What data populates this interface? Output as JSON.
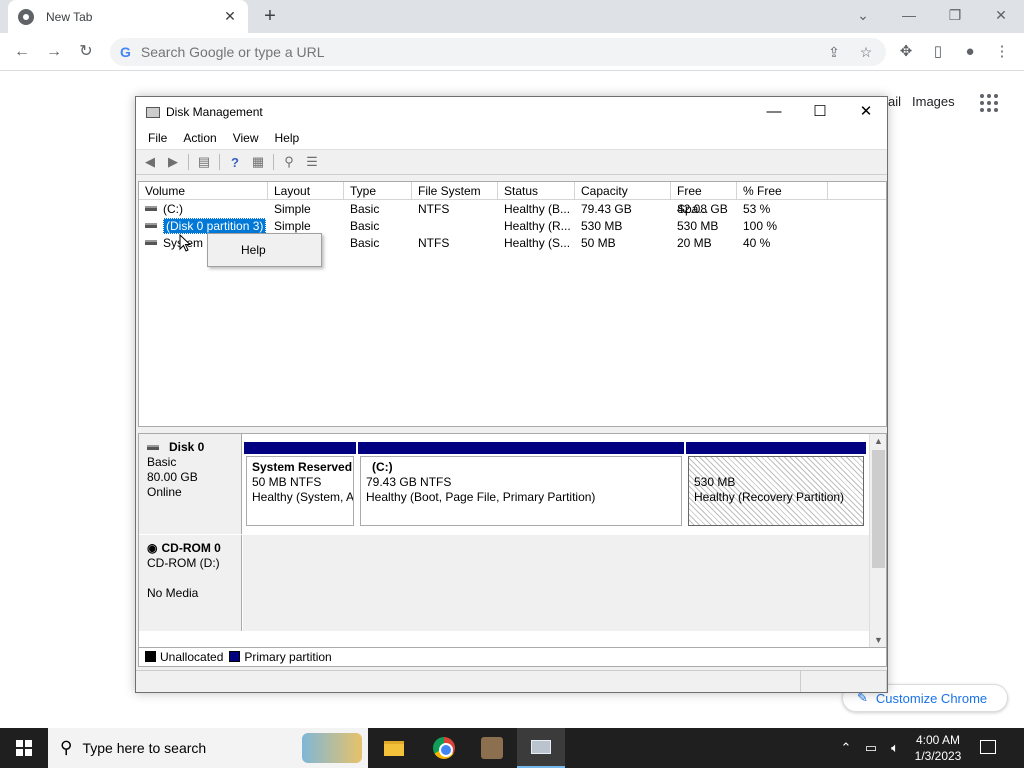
{
  "browser": {
    "tab_title": "New Tab",
    "tab_close": "✕",
    "new_tab": "+",
    "omnibox_placeholder": "Search Google or type a URL",
    "links": [
      "ail",
      "Images"
    ],
    "customize_label": "Customize Chrome"
  },
  "dm": {
    "title": "Disk Management",
    "menu": [
      "File",
      "Action",
      "View",
      "Help"
    ],
    "columns": [
      "Volume",
      "Layout",
      "Type",
      "File System",
      "Status",
      "Capacity",
      "Free Spa...",
      "% Free"
    ],
    "rows": [
      [
        "(C:)",
        "Simple",
        "Basic",
        "NTFS",
        "Healthy (B...",
        "79.43 GB",
        "42.08 GB",
        "53 %"
      ],
      [
        "(Disk 0 partition 3)",
        "Simple",
        "Basic",
        "",
        "Healthy (R...",
        "530 MB",
        "530 MB",
        "100 %"
      ],
      [
        "System R",
        "",
        "Basic",
        "NTFS",
        "Healthy (S...",
        "50 MB",
        "20 MB",
        "40 %"
      ]
    ],
    "context_menu_item": "Help",
    "disk0": {
      "name": "Disk 0",
      "type": "Basic",
      "size": "80.00 GB",
      "state": "Online",
      "partitions": [
        {
          "title": "System Reserved",
          "line1": "50 MB NTFS",
          "line2": "Healthy (System, A"
        },
        {
          "title": "(C:)",
          "line1": "79.43 GB NTFS",
          "line2": "Healthy (Boot, Page File, Primary Partition)"
        },
        {
          "title": "",
          "line1": "530 MB",
          "line2": "Healthy (Recovery Partition)"
        }
      ]
    },
    "cdrom": {
      "name": "CD-ROM 0",
      "type": "CD-ROM (D:)",
      "state": "No Media"
    },
    "legend": [
      "Unallocated",
      "Primary partition"
    ]
  },
  "taskbar": {
    "search_placeholder": "Type here to search",
    "time": "4:00 AM",
    "date": "1/3/2023"
  },
  "colors": {
    "primary_partition": "#000080",
    "selection": "#0078d7",
    "taskbar": "#1f1f1f"
  }
}
